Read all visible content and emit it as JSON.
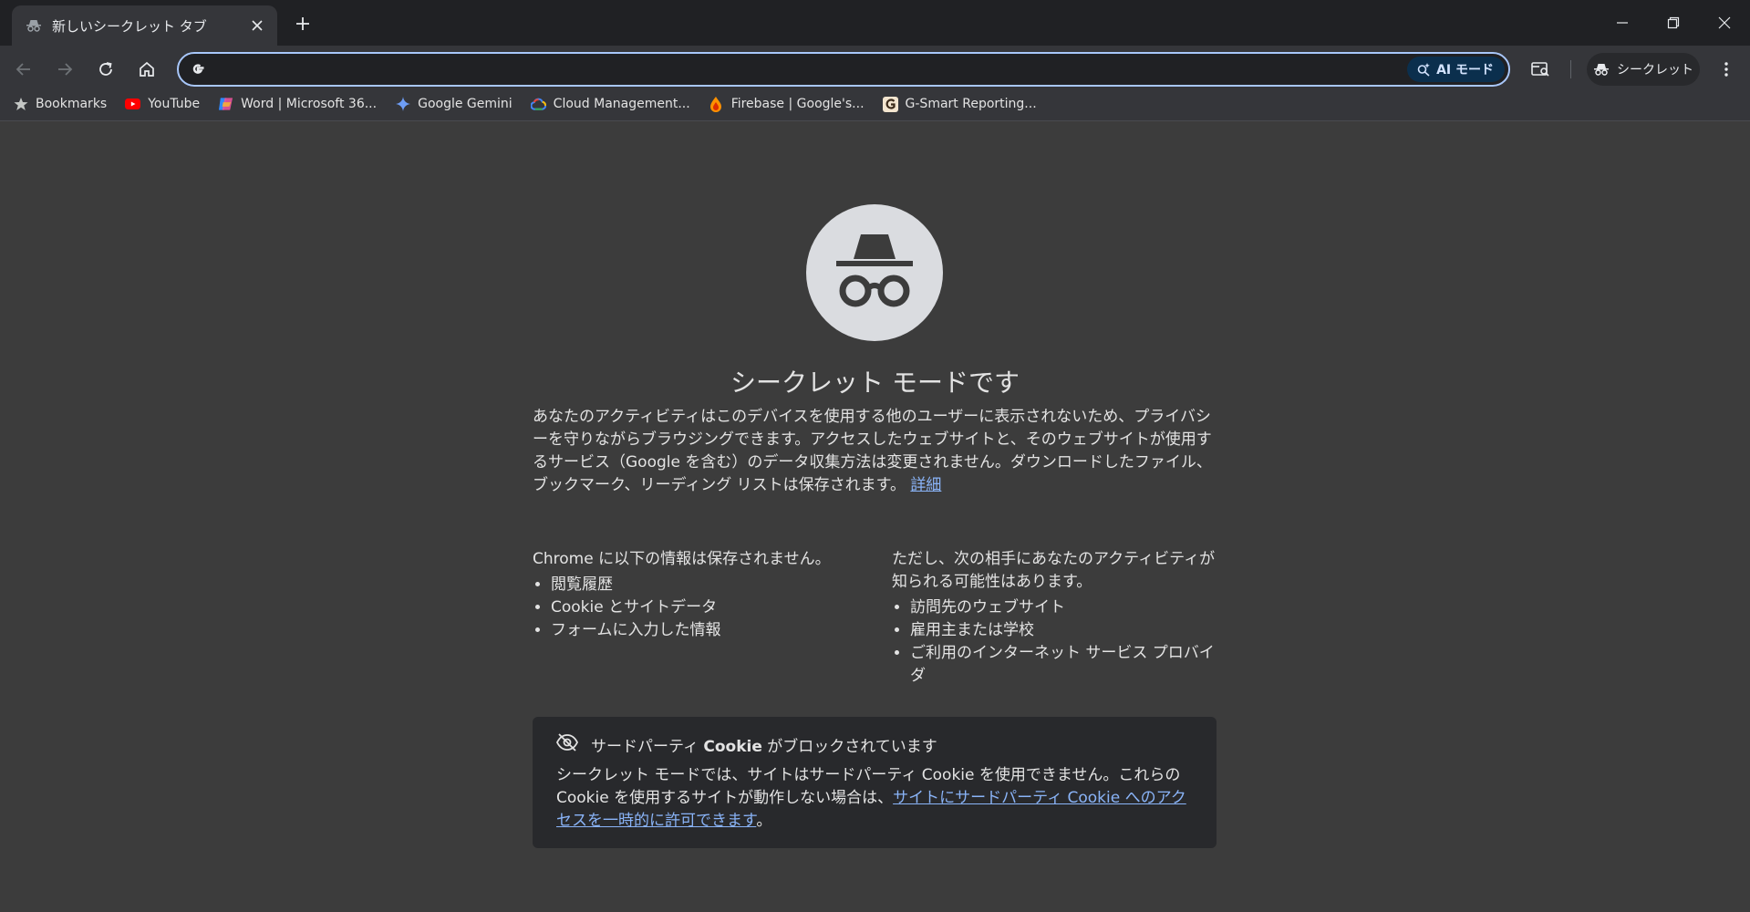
{
  "tab": {
    "title": "新しいシークレット タブ"
  },
  "omnibox": {
    "value": "",
    "placeholder": "",
    "ai_mode_label": "AI モード"
  },
  "profile": {
    "label": "シークレット"
  },
  "bookmarks": [
    {
      "label": "Bookmarks",
      "icon": "star-icon"
    },
    {
      "label": "YouTube",
      "icon": "youtube-icon"
    },
    {
      "label": "Word | Microsoft 36...",
      "icon": "microsoft-copilot-icon"
    },
    {
      "label": "Google Gemini",
      "icon": "gemini-icon"
    },
    {
      "label": "Cloud Management...",
      "icon": "google-cloud-icon"
    },
    {
      "label": "Firebase | Google's...",
      "icon": "firebase-icon"
    },
    {
      "label": "G-Smart Reporting...",
      "icon": "g-smart-icon"
    }
  ],
  "page": {
    "heading": "シークレット モードです",
    "intro": "あなたのアクティビティはこのデバイスを使用する他のユーザーに表示されないため、プライバシーを守りながらブラウジングできます。アクセスしたウェブサイトと、そのウェブサイトが使用するサービス（Google を含む）のデータ収集方法は変更されません。ダウンロードしたファイル、ブックマーク、リーディング リストは保存されます。",
    "learn_more": "詳細",
    "not_saved_title": "Chrome に以下の情報は保存されません。",
    "not_saved_items": [
      "閲覧履歴",
      "Cookie とサイトデータ",
      "フォームに入力した情報"
    ],
    "visible_title": "ただし、次の相手にあなたのアクティビティが知られる可能性はあります。",
    "visible_items": [
      "訪問先のウェブサイト",
      "雇用主または学校",
      "ご利用のインターネット サービス プロバイダ"
    ],
    "cookie_title_pre": "サードパーティ ",
    "cookie_title_bold": "Cookie",
    "cookie_title_post": " がブロックされています",
    "cookie_body": "シークレット モードでは、サイトはサードパーティ Cookie を使用できません。これらの Cookie を使用するサイトが動作しない場合は、",
    "cookie_link": "サイトにサードパーティ Cookie へのアクセスを一時的に許可できます",
    "cookie_end": "。"
  }
}
